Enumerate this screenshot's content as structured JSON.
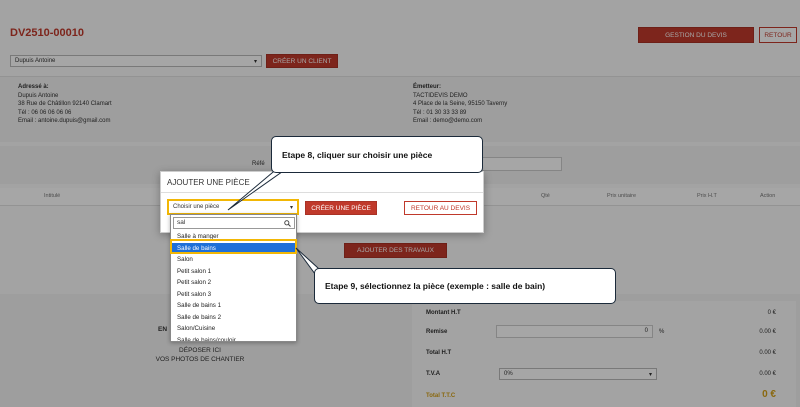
{
  "header": {
    "title": "DV2510-00010",
    "manage_label": "GESTION DU DEVIS",
    "back_label": "RETOUR"
  },
  "client": {
    "selected": "Dupuis Antoine",
    "create_label": "CRÉER UN CLIENT"
  },
  "address": {
    "heading": "Adressé à:",
    "name": "Dupuis Antoine",
    "street": "38 Rue de Châtillon 92140 Clamart",
    "phone": "Tél : 06 06 06 06 06",
    "email": "Email : antoine.dupuis@gmail.com"
  },
  "emitter": {
    "heading": "Émetteur:",
    "name": "TACTIDEVIS DEMO",
    "street": "4 Place de la Seine, 95150 Taverny",
    "phone": "Tél : 01 30 33 33 89",
    "email": "Email : demo@demo.com"
  },
  "reference": {
    "label": "Réfé"
  },
  "table": {
    "headers": [
      "Intitulé",
      "Qté",
      "Prix unitaire",
      "Prix H.T",
      "Action"
    ]
  },
  "works": {
    "add_label": "AJOUTER DES TRAVAUX"
  },
  "photos": {
    "label_part": "EN",
    "line1": "DÉPOSER ICI",
    "line2": "VOS PHOTOS DE CHANTIER"
  },
  "totals": {
    "montant_ht_label": "Montant H.T",
    "montant_ht_value": "0 €",
    "remise_label": "Remise",
    "remise_input": "0",
    "remise_unit": "%",
    "remise_value": "0.00 €",
    "total_ht_label": "Total H.T",
    "total_ht_value": "0.00 €",
    "tva_label": "T.V.A",
    "tva_selected": "0%",
    "tva_value": "0.00 €",
    "ttc_label": "Total T.T.C",
    "ttc_value": "0 €"
  },
  "modal": {
    "title": "AJOUTER UNE PIÈCE",
    "select_placeholder": "Choisir une pièce",
    "create_label": "CRÉER UNE PIÈCE",
    "back_label": "RETOUR AU DEVIS",
    "search_value": "sal",
    "options": [
      "Salle à manger",
      "Salle de bains",
      "Salon",
      "Petit salon 1",
      "Petit salon 2",
      "Petit salon 3",
      "Salle de bains 1",
      "Salle de bains 2",
      "Salon/Cuisine",
      "Salle de bains/couloir"
    ],
    "selected_index": 1
  },
  "callouts": {
    "step8": "Etape 8, cliquer sur choisir une pièce",
    "step9": "Etape 9, sélectionnez la pièce (exemple : salle de bain)"
  },
  "colors": {
    "accent": "#c0392b",
    "highlight": "#f2b705",
    "selected_option": "#1e6fd9",
    "callout_border": "#1b2a3a"
  }
}
